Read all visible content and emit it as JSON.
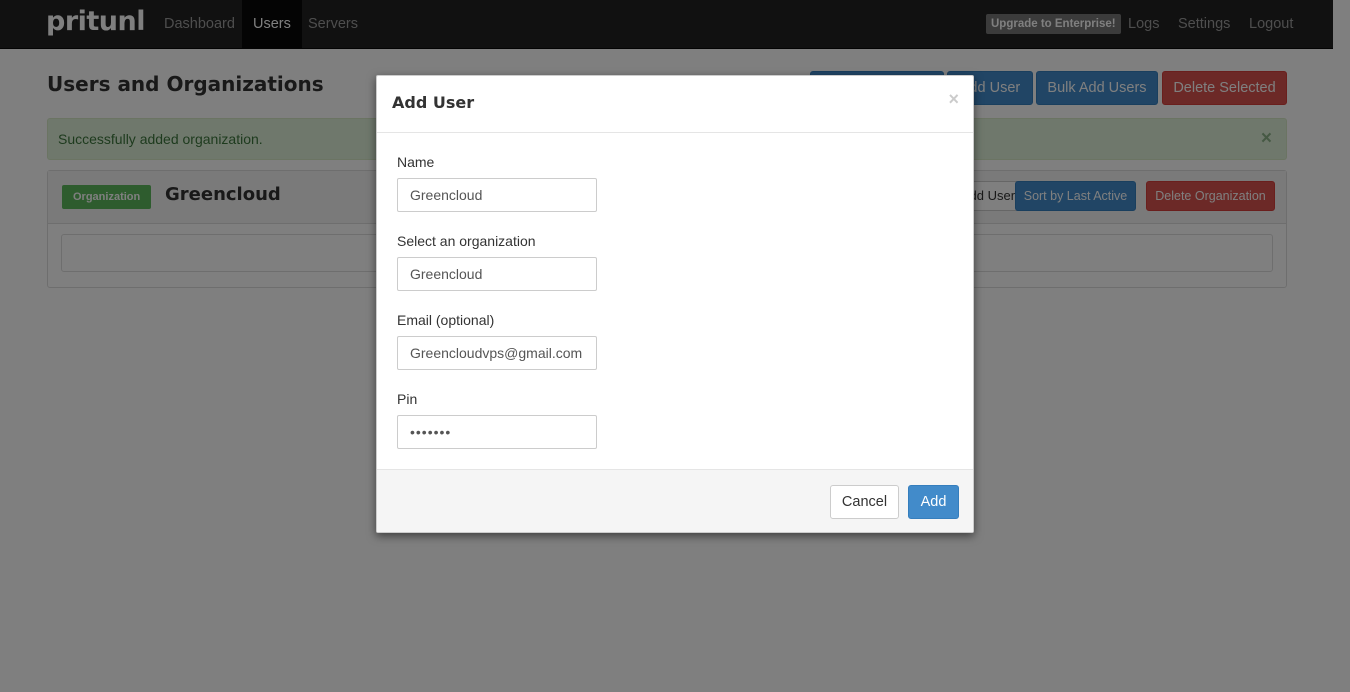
{
  "navbar": {
    "brand": "pritunl",
    "links": {
      "dashboard": "Dashboard",
      "users": "Users",
      "servers": "Servers"
    },
    "upgrade": "Upgrade to Enterprise!",
    "right_links": {
      "logs": "Logs",
      "settings": "Settings",
      "logout": "Logout"
    }
  },
  "page": {
    "title": "Users and Organizations",
    "buttons": {
      "add_user": "Add User",
      "bulk_add": "Bulk Add Users",
      "delete_selected": "Delete Selected"
    },
    "alert": {
      "message": "Successfully added organization.",
      "close": "×"
    }
  },
  "organization": {
    "label": "Organization",
    "name": "Greencloud",
    "buttons": {
      "add_user": "Add User",
      "sort": "Sort by Last Active",
      "delete": "Delete Organization"
    }
  },
  "modal": {
    "title": "Add User",
    "close": "×",
    "fields": {
      "name": {
        "label": "Name",
        "value": "Greencloud"
      },
      "organization": {
        "label": "Select an organization",
        "value": "Greencloud"
      },
      "email": {
        "label": "Email (optional)",
        "value": "Greencloudvps@gmail.com"
      },
      "pin": {
        "label": "Pin",
        "value": "•••••••"
      }
    },
    "buttons": {
      "cancel": "Cancel",
      "add": "Add"
    }
  },
  "colors": {
    "primary": "#428bca",
    "danger": "#d9534f",
    "success": "#5cb85c",
    "navbar": "#222222"
  }
}
